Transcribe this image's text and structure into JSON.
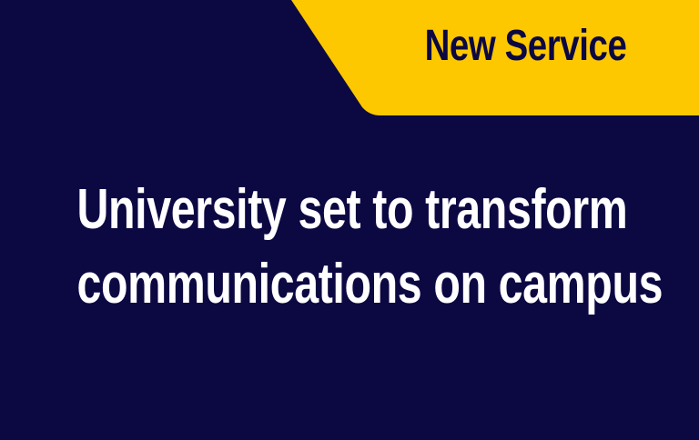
{
  "banner": {
    "label": "New Service"
  },
  "headline": {
    "line1": "University set to transform",
    "line2": "communications on campus"
  },
  "colors": {
    "background": "#0c0842",
    "banner": "#fdc800",
    "headline_text": "#ffffff",
    "banner_text": "#0c0842"
  }
}
